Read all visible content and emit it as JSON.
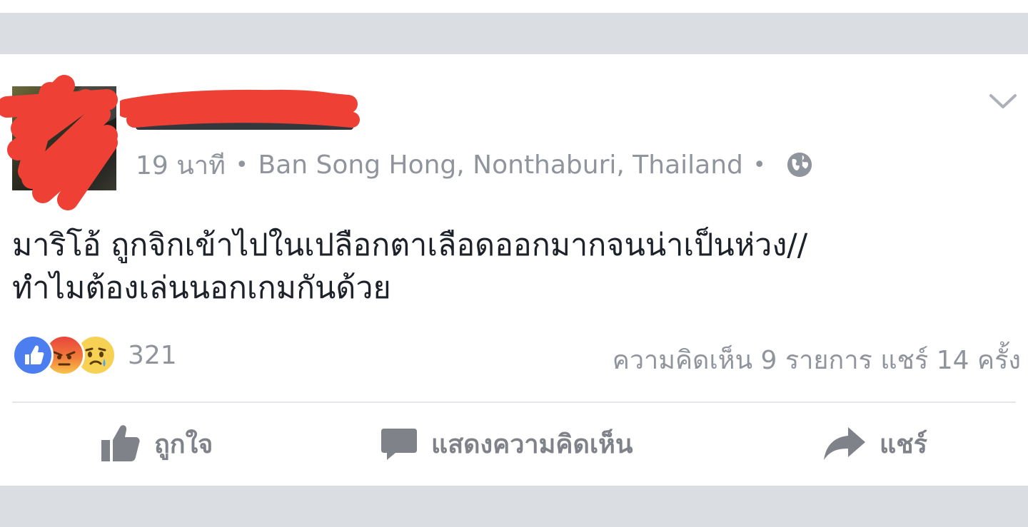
{
  "post": {
    "author_name": "",
    "time": "19 นาที",
    "location": "Ban Song Hong, Nonthaburi, Thailand",
    "separator": "•",
    "privacy_icon": "globe-icon",
    "menu_icon": "chevron-down-icon",
    "text": "มาริโอ้ ถูกจิกเข้าไปในเปลือกตาเลือดออกมากจนน่าเป็นห่วง//\nทำไมต้องเล่นนอกเกมกันด้วย"
  },
  "reactions": {
    "icons": [
      "like-icon",
      "angry-icon",
      "sad-icon"
    ],
    "count": "321"
  },
  "stats": {
    "comments": "ความคิดเห็น 9 รายการ",
    "shares": "แชร์ 14 ครั้ง"
  },
  "actions": {
    "like": "ถูกใจ",
    "comment": "แสดงความคิดเห็น",
    "share": "แชร์"
  },
  "colors": {
    "band": "#dadde1",
    "meta_gray": "#90949c",
    "action_gray": "#7f8289",
    "like_blue": "#4c7ef0",
    "redaction_red": "#ee4035"
  }
}
